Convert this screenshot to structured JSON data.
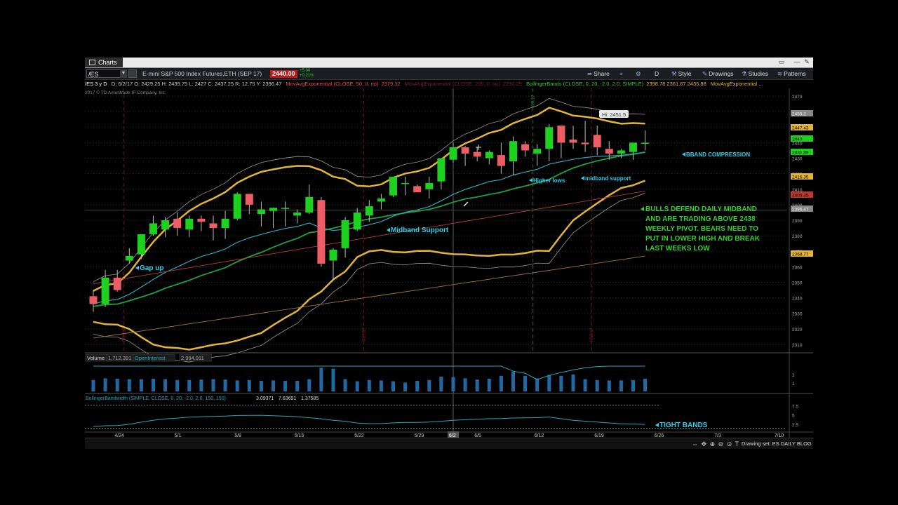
{
  "window": {
    "tab_label": "Charts",
    "symbol": "/ES",
    "description": "E-mini S&P 500 Index Futures,ETH (SEP 17)",
    "last_price": "2440.00",
    "change": "+5.00",
    "change_pct": "+0.21%",
    "toolbar": {
      "share": "Share",
      "period": "D",
      "style": "Style",
      "drawings": "Drawings",
      "studies": "Studies",
      "patterns": "Patterns"
    }
  },
  "study_line": {
    "period": "/ES 3 y D",
    "ohlc": "D: 6/2/17   O: 2429.25   H: 2439.75   L: 2427   C: 2437.25   R: 12.75   Y: 2396.47",
    "ema50": "MovAvgExponential (CLOSE, 50, 0, no)",
    "ema50_val": "2379.32",
    "ema200": "MovAvgExponential (CLOSE, 200, 0, no)",
    "ema200_val": "2290.29",
    "bb": "BollingerBands (CLOSE, 0, 20, -2.0, 2.0, SIMPLE)",
    "bb_vals": "2398.78   2361.67   2435.88",
    "ema_last": "MovAvgExponential ...",
    "copyright": "2017 © TD Ameritrade IP Company, Inc."
  },
  "price_axis": {
    "ticks": [
      "2470",
      "2460",
      "2450",
      "2440",
      "2430",
      "2420",
      "2410",
      "2400",
      "2390",
      "2380",
      "2370",
      "2360",
      "2350",
      "2340",
      "2330",
      "2320",
      "2310"
    ],
    "labels": [
      {
        "text": "2455.2",
        "color": "#888888"
      },
      {
        "text": "2447.43",
        "color": "#e3b535"
      },
      {
        "text": "2440",
        "color": "#1fd11f"
      },
      {
        "text": "2431.89",
        "color": "#1fd11f"
      },
      {
        "text": "2416.35",
        "color": "#e3b535"
      },
      {
        "text": "2405.35",
        "color": "#c0392b"
      },
      {
        "text": "2396.47",
        "color": "#888888"
      },
      {
        "text": "2368.77",
        "color": "#e3b535"
      }
    ],
    "high_label": "Hi: 2451.5"
  },
  "annotations": {
    "gap_up": "Gap up",
    "midband_support": "Midband Support",
    "higher_lows": "Higher lows",
    "midband_support_2": "midband support",
    "bband_compression": "BBAND COMPRESSION",
    "bulls_text": [
      "BULLS DEFEND DAILY MIDBAND",
      "AND ARE TRADING ABOVE 2438",
      "WEEKLY PIVOT. BEARS NEED TO",
      "PUT IN LOWER HIGH AND BREAK",
      "LAST WEEKS LOW"
    ],
    "tight_bands": "TIGHT BANDS"
  },
  "events": [
    "5/19/17",
    "5/19/17",
    "6/9/17",
    "6/19/17"
  ],
  "volume_panel": {
    "label": "Volume",
    "value": "1,712,391",
    "oi_label": "OpenInterest",
    "oi_value": "2,994,911",
    "ticks": [
      "2",
      "1"
    ]
  },
  "bbw_panel": {
    "label": "BollingerBandwidth (SIMPLE, CLOSE, 0, 20, -2.0, 2.0, 150, 150)",
    "v1": "3.09371",
    "v2": "7.63691",
    "v3": "1.37585",
    "ticks": [
      "7.5",
      "5",
      "2.5"
    ]
  },
  "dates": [
    "4/24",
    "5/1",
    "5/8",
    "5/15",
    "5/22",
    "5/29",
    "6/5",
    "6/12",
    "6/19",
    "6/26",
    "7/3",
    "7/10"
  ],
  "cursor_date": "6/2",
  "status": {
    "drawing_set": "Drawing set: ES DAILY BLOG ..."
  },
  "colors": {
    "up": "#1fd11f",
    "down": "#ee5c66",
    "bb": "#e3b535",
    "midband": "#1fa040",
    "annotation": "#2ad0ee",
    "note": "#32d12b"
  },
  "chart_data": {
    "type": "candlestick",
    "x": [
      "4/20",
      "4/21",
      "4/24",
      "4/25",
      "4/26",
      "4/27",
      "4/28",
      "5/1",
      "5/2",
      "5/3",
      "5/4",
      "5/5",
      "5/8",
      "5/9",
      "5/10",
      "5/11",
      "5/12",
      "5/15",
      "5/16",
      "5/17",
      "5/18",
      "5/19",
      "5/22",
      "5/23",
      "5/24",
      "5/25",
      "5/26",
      "5/30",
      "5/31",
      "6/1",
      "6/2",
      "6/5",
      "6/6",
      "6/7",
      "6/8",
      "6/9",
      "6/12",
      "6/13",
      "6/14",
      "6/15",
      "6/16",
      "6/19",
      "6/20",
      "6/21",
      "6/22",
      "6/23",
      "6/26"
    ],
    "ohlc": [
      [
        2341,
        2345,
        2331,
        2336
      ],
      [
        2336,
        2358,
        2334,
        2353
      ],
      [
        2353,
        2358,
        2344,
        2345
      ],
      [
        2364,
        2372,
        2362,
        2367
      ],
      [
        2368,
        2380,
        2365,
        2381
      ],
      [
        2381,
        2393,
        2380,
        2388
      ],
      [
        2384,
        2392,
        2379,
        2390
      ],
      [
        2391,
        2395,
        2380,
        2385
      ],
      [
        2384,
        2393,
        2379,
        2391
      ],
      [
        2391,
        2393,
        2383,
        2389
      ],
      [
        2388,
        2393,
        2377,
        2385
      ],
      [
        2385,
        2396,
        2378,
        2391
      ],
      [
        2391,
        2408,
        2390,
        2407
      ],
      [
        2407,
        2405,
        2394,
        2400
      ],
      [
        2394,
        2402,
        2386,
        2397
      ],
      [
        2396,
        2398,
        2385,
        2398
      ],
      [
        2398,
        2402,
        2386,
        2398
      ],
      [
        2393,
        2397,
        2388,
        2395
      ],
      [
        2395,
        2413,
        2394,
        2405
      ],
      [
        2403,
        2405,
        2360,
        2362
      ],
      [
        2364,
        2372,
        2352,
        2371
      ],
      [
        2372,
        2392,
        2366,
        2390
      ],
      [
        2384,
        2398,
        2383,
        2395
      ],
      [
        2393,
        2403,
        2389,
        2399
      ],
      [
        2402,
        2407,
        2397,
        2404
      ],
      [
        2406,
        2418,
        2405,
        2418
      ],
      [
        2414,
        2418,
        2406,
        2414
      ],
      [
        2412,
        2413,
        2408,
        2408
      ],
      [
        2410,
        2418,
        2404,
        2414
      ],
      [
        2415,
        2430,
        2410,
        2430
      ],
      [
        2429,
        2440,
        2427,
        2437
      ],
      [
        2437,
        2438,
        2425,
        2433
      ],
      [
        2434,
        2437,
        2428,
        2431
      ],
      [
        2430,
        2435,
        2426,
        2434
      ],
      [
        2432,
        2440,
        2420,
        2425
      ],
      [
        2428,
        2444,
        2419,
        2441
      ],
      [
        2439,
        2441,
        2431,
        2435
      ],
      [
        2433,
        2439,
        2425,
        2436
      ],
      [
        2436,
        2452,
        2428,
        2450
      ],
      [
        2451,
        2446,
        2430,
        2440
      ],
      [
        2442,
        2451,
        2436,
        2440
      ],
      [
        2440,
        2454,
        2434,
        2439
      ],
      [
        2445,
        2451,
        2432,
        2437
      ],
      [
        2436,
        2441,
        2429,
        2433
      ],
      [
        2433,
        2436,
        2430,
        2435
      ],
      [
        2434,
        2440,
        2429,
        2440
      ],
      [
        2440,
        2448,
        2435,
        2440
      ]
    ],
    "volume": [
      1.35,
      1.55,
      1.5,
      1.45,
      1.45,
      1.5,
      1.45,
      1.35,
      1.35,
      1.4,
      1.45,
      1.4,
      1.3,
      1.35,
      1.25,
      1.3,
      1.25,
      1.25,
      1.45,
      2.8,
      2.7,
      1.45,
      1.2,
      1.35,
      1.3,
      1.2,
      1.05,
      1.25,
      1.35,
      1.75,
      1.7,
      1.55,
      1.4,
      1.5,
      1.85,
      2.35,
      1.85,
      1.55,
      1.95,
      1.85,
      2.0,
      1.45,
      1.35,
      1.3,
      1.3,
      1.35,
      1.5
    ],
    "ylim": [
      2305,
      2475
    ]
  }
}
